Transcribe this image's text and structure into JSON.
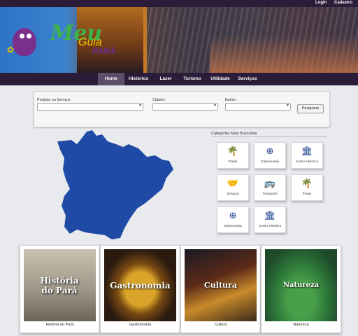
{
  "topbar": {
    "login": "Login",
    "signup": "Cadastro"
  },
  "logo": {
    "line1": "Meu",
    "line2": "Guia",
    "line3": "PARÁ"
  },
  "nav": {
    "items": [
      "Home",
      "Histórico",
      "Lazer",
      "Turismo",
      "Utilidade",
      "Serviços"
    ],
    "active": "Home"
  },
  "search": {
    "product_label": "Produto ou Serviço:",
    "city_label": "Cidade:",
    "district_label": "Bairro:",
    "button": "Pesquisar"
  },
  "categories": {
    "title": "Categorias Mais Buscadas",
    "items": [
      {
        "label": "Praias",
        "icon": "palm-tree-icon"
      },
      {
        "label": "Gastronomia",
        "icon": "restaurant-icon"
      },
      {
        "label": "Centro Histórico",
        "icon": "museum-icon"
      },
      {
        "label": "Serviços",
        "icon": "handshake-icon"
      },
      {
        "label": "Transporte",
        "icon": "bus-icon"
      },
      {
        "label": "Praias",
        "icon": "palm-tree-icon"
      },
      {
        "label": "Gastronomia",
        "icon": "restaurant-icon"
      },
      {
        "label": "Centro Histórico",
        "icon": "museum-icon"
      }
    ]
  },
  "cards": [
    {
      "overlay": "História do Pará",
      "caption": "História do Pará"
    },
    {
      "overlay": "Gastronomia",
      "caption": "Gastronomia"
    },
    {
      "overlay": "Cultura",
      "caption": "Cultura"
    },
    {
      "overlay": "Natureza",
      "caption": "Natureza"
    }
  ],
  "colors": {
    "header": "#2b1d3a",
    "map_fill": "#1f4aa5",
    "icon_color": "#1d3f8a"
  }
}
